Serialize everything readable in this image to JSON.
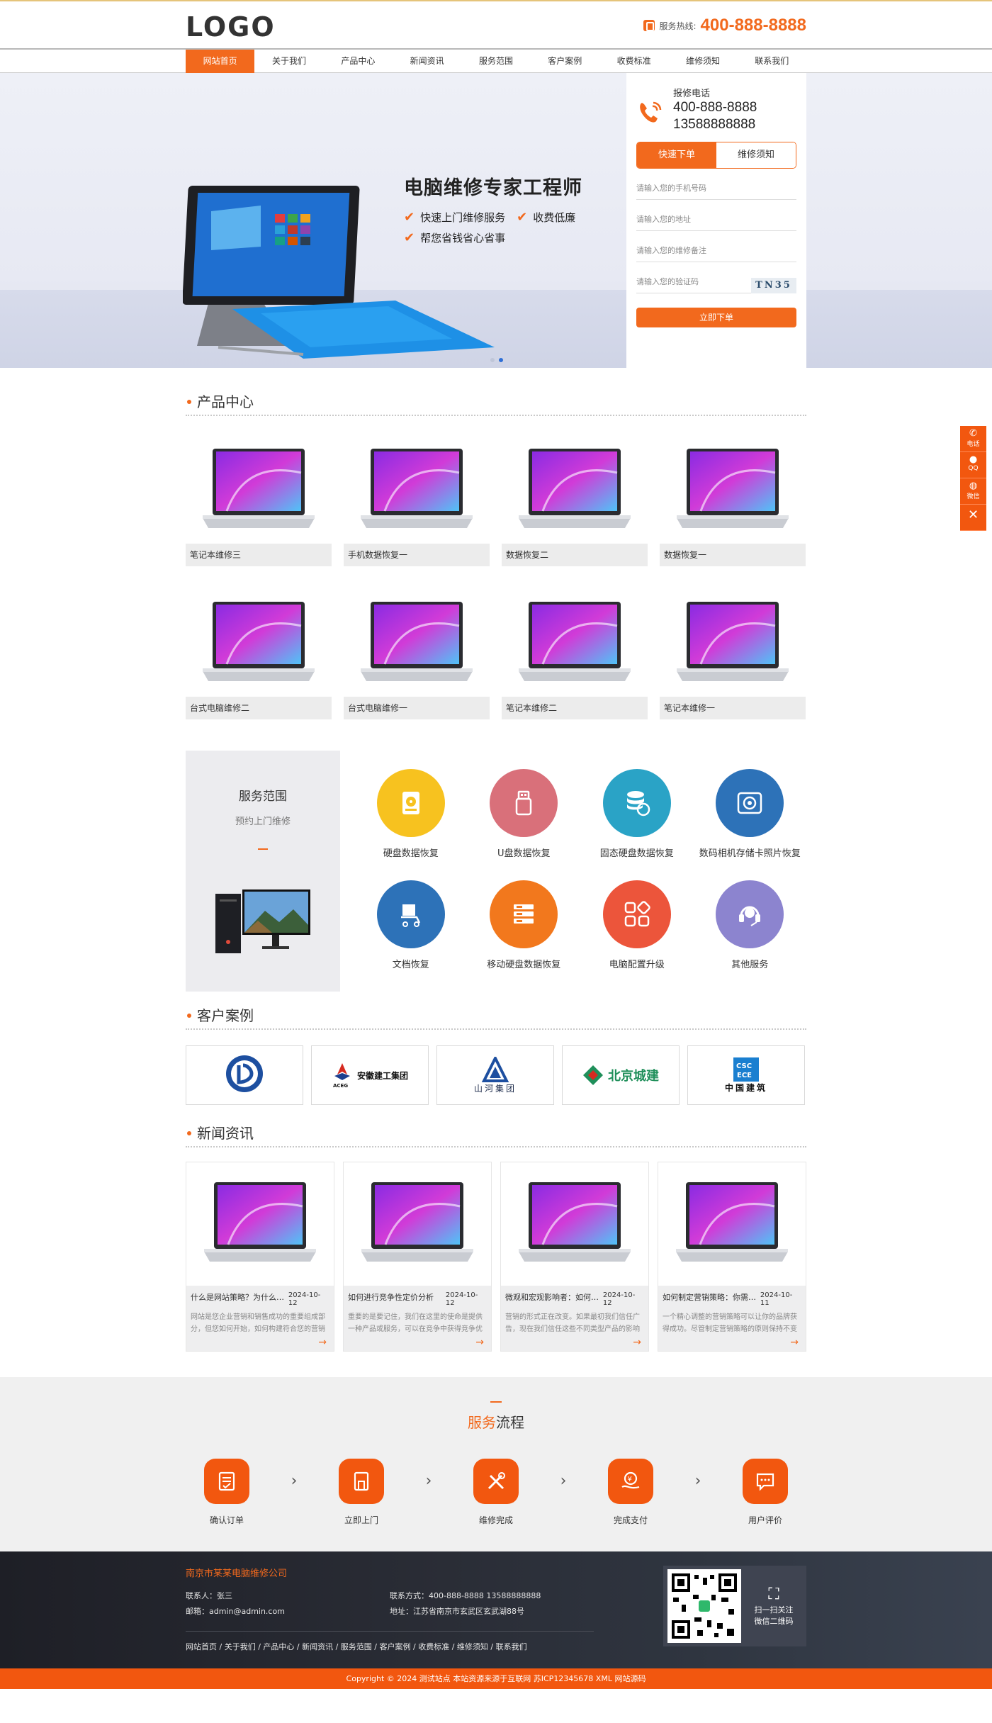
{
  "header": {
    "logo": "LOGO",
    "hotline_label": "服务热线:",
    "hotline_number": "400-888-8888"
  },
  "nav": {
    "items": [
      "网站首页",
      "关于我们",
      "产品中心",
      "新闻资讯",
      "服务范围",
      "客户案例",
      "收费标准",
      "维修须知",
      "联系我们"
    ]
  },
  "banner": {
    "title": "电脑维修专家工程师",
    "features": [
      "快速上门维修服务",
      "收费低廉",
      "帮您省钱省心省事"
    ]
  },
  "order_form": {
    "phone_label": "报修电话",
    "phone_1": "400-888-8888",
    "phone_2": "13588888888",
    "tab_active": "快速下单",
    "tab_other": "维修须知",
    "field_phone": "请输入您的手机号码",
    "field_address": "请输入您的地址",
    "field_note": "请输入您的维修备注",
    "field_captcha": "请输入您的验证码",
    "captcha_text": "TN35",
    "submit": "立即下单"
  },
  "products": {
    "title": "产品中心",
    "items": [
      "笔记本维修三",
      "手机数据恢复一",
      "数据恢复二",
      "数据恢复一",
      "台式电脑维修二",
      "台式电脑维修一",
      "笔记本维修二",
      "笔记本维修一"
    ]
  },
  "services": {
    "title": "服务范围",
    "subtitle": "预约上门维修",
    "items": [
      {
        "name": "硬盘数据恢复",
        "color": "#f7c21f",
        "icon": "hard-disk-icon"
      },
      {
        "name": "U盘数据恢复",
        "color": "#d9707a",
        "icon": "usb-icon"
      },
      {
        "name": "固态硬盘数据恢复",
        "color": "#2aa3c6",
        "icon": "database-icon"
      },
      {
        "name": "数码相机存储卡照片恢复",
        "color": "#2d72b8",
        "icon": "camera-icon"
      },
      {
        "name": "文档恢复",
        "color": "#2d72b8",
        "icon": "document-cart-icon"
      },
      {
        "name": "移动硬盘数据恢复",
        "color": "#f2781d",
        "icon": "server-icon"
      },
      {
        "name": "电脑配置升级",
        "color": "#ec553b",
        "icon": "apps-icon"
      },
      {
        "name": "其他服务",
        "color": "#8c84cf",
        "icon": "headset-icon"
      }
    ]
  },
  "cases": {
    "title": "客户案例",
    "items": [
      "安徽建工集团",
      "山河集团",
      "北京城建",
      "中国建筑"
    ]
  },
  "news": {
    "title": "新闻资讯",
    "items": [
      {
        "title": "什么是网站策略？为什么它很重要？",
        "date": "2024-10-12",
        "desc": "网站是您企业营销和销售成功的重要组成部分，但您如何开始，如何构建符合您的营销策略"
      },
      {
        "title": "如何进行竞争性定价分析",
        "date": "2024-10-12",
        "desc": "重要的是要记住，我们在这里的使命是提供一种产品或服务，可以在竞争中获得竞争优势"
      },
      {
        "title": "微观和宏观影响者：如何选择",
        "date": "2024-10-12",
        "desc": "营销的形式正在改变。如果最初我们信任广告，现在我们信任这些不同类型产品的影响者"
      },
      {
        "title": "如何制定营销策略：你需要知道",
        "date": "2024-10-11",
        "desc": "一个精心调整的营销策略可以让你的品牌获得成功。尽管制定营销策略的原则保持不变"
      }
    ]
  },
  "flow": {
    "title_accent": "服务",
    "title_rest": "流程",
    "steps": [
      "确认订单",
      "立即上门",
      "维修完成",
      "完成支付",
      "用户评价"
    ]
  },
  "footer": {
    "company": "南京市某某电脑维修公司",
    "contact": "联系人：张三",
    "email": "邮箱：admin@admin.com",
    "phone": "联系方式：400-888-8888 13588888888",
    "address": "地址：江苏省南京市玄武区玄武湖88号",
    "links": "网站首页 / 关于我们 / 产品中心 / 新闻资讯 / 服务范围 / 客户案例 / 收费标准 / 维修须知 / 联系我们",
    "qr_text_1": "扫一扫关注",
    "qr_text_2": "微信二维码",
    "copyright": "Copyright © 2024 测试站点 本站资源来源于互联网  苏ICP12345678  XML  网站源码"
  },
  "side_bar": [
    "电话",
    "QQ",
    "微信"
  ],
  "colors": {
    "accent": "#f2691d",
    "footer_bg": "#2a2d36"
  }
}
